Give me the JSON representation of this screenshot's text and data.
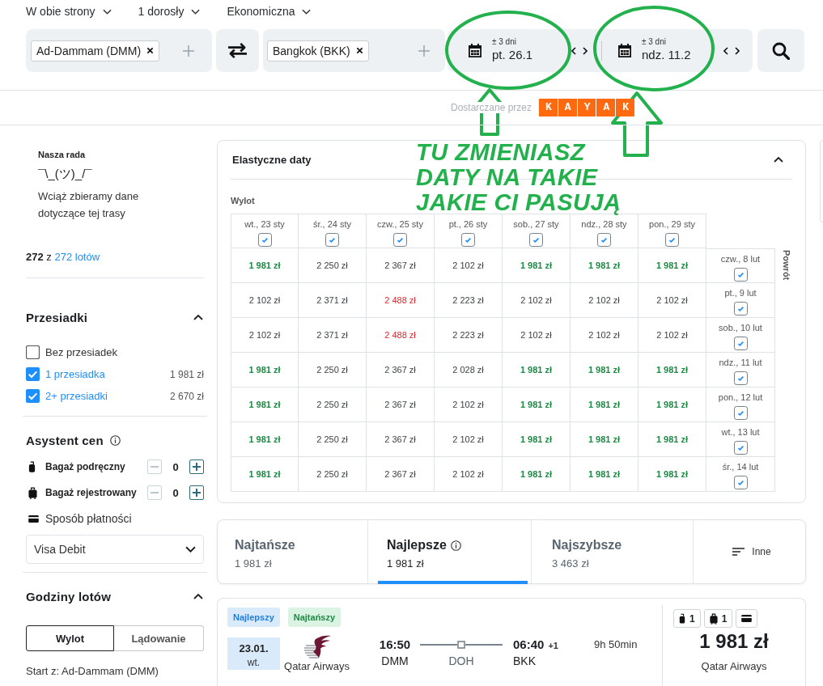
{
  "trip_options": [
    {
      "label": "W obie strony"
    },
    {
      "label": "1 dorosły"
    },
    {
      "label": "Ekonomiczna"
    }
  ],
  "search": {
    "origin": "Ad-Dammam (DMM)",
    "destination": "Bangkok (BKK)",
    "dates": [
      {
        "flex": "± 3 dni",
        "value": "pt. 26.1"
      },
      {
        "flex": "± 3 dni",
        "value": "ndz. 11.2"
      }
    ]
  },
  "provider": {
    "label": "Dostarczane przez",
    "logo": "KAYAK"
  },
  "annotation": {
    "lines": [
      "TU ZMIENIASZ",
      "DATY NA TAKIE",
      "JAKIE CI PASUJĄ"
    ]
  },
  "sidebar": {
    "advice": {
      "title": "Nasza rada",
      "shrug": "¯\\_(ツ)_/¯",
      "text": "Wciąż zbieramy dane dotyczące tej trasy"
    },
    "count": {
      "text": "**272** z",
      "link": "272 lotów"
    },
    "stops": {
      "title": "Przesiadki",
      "expanded": true,
      "options": [
        {
          "label": "Bez przesiadek",
          "checked": false
        },
        {
          "label": "1 przesiadka",
          "checked": true,
          "price": "1 981 zł"
        },
        {
          "label": "2+ przesiadki",
          "checked": true,
          "price": "2 670 zł"
        }
      ]
    },
    "price_assistant": {
      "title": "Asystent cen",
      "bags": [
        {
          "kind": "carry_on",
          "label": "Bagaż podręczny",
          "count": "0",
          "decrease_disabled": true
        },
        {
          "kind": "checked_bag",
          "label": "Bagaż rejestrowany",
          "count": "0",
          "decrease_disabled": true
        }
      ],
      "payment": {
        "label": "Sposób płatności",
        "value": "Visa Debit"
      }
    },
    "flight_times": {
      "title": "Godziny lotów",
      "expanded": true,
      "modes": [
        {
          "label": "Wylot",
          "selected": true
        },
        {
          "label": "Lądowanie",
          "selected": false
        }
      ],
      "start": "Start z: Ad-Dammam (DMM)"
    }
  },
  "flexible_dates": {
    "title": "Elastyczne daty",
    "expanded": true,
    "departure_label": "Wylot",
    "return_label": "Powrót",
    "departures": [
      {
        "label": "wt., 23 sty",
        "checked": true
      },
      {
        "label": "śr., 24 sty",
        "checked": true
      },
      {
        "label": "czw., 25 sty",
        "checked": true
      },
      {
        "label": "pt., 26 sty",
        "checked": true
      },
      {
        "label": "sob., 27 sty",
        "checked": true
      },
      {
        "label": "ndz., 28 sty",
        "checked": true
      },
      {
        "label": "pon., 29 sty",
        "checked": true
      }
    ],
    "returns": [
      {
        "label": "czw., 8 lut",
        "checked": true,
        "prices": [
          {
            "text": "1 981 zł",
            "kind": "low"
          },
          {
            "text": "2 250 zł",
            "kind": "mid"
          },
          {
            "text": "2 367 zł",
            "kind": "mid"
          },
          {
            "text": "2 102 zł",
            "kind": "mid"
          },
          {
            "text": "1 981 zł",
            "kind": "low"
          },
          {
            "text": "1 981 zł",
            "kind": "low"
          },
          {
            "text": "1 981 zł",
            "kind": "low"
          }
        ]
      },
      {
        "label": "pt., 9 lut",
        "checked": true,
        "prices": [
          {
            "text": "2 102 zł",
            "kind": "mid"
          },
          {
            "text": "2 371 zł",
            "kind": "mid"
          },
          {
            "text": "2 488 zł",
            "kind": "high"
          },
          {
            "text": "2 223 zł",
            "kind": "mid"
          },
          {
            "text": "2 102 zł",
            "kind": "mid"
          },
          {
            "text": "2 102 zł",
            "kind": "mid"
          },
          {
            "text": "2 102 zł",
            "kind": "mid"
          }
        ]
      },
      {
        "label": "sob., 10 lut",
        "checked": true,
        "prices": [
          {
            "text": "2 102 zł",
            "kind": "mid"
          },
          {
            "text": "2 371 zł",
            "kind": "mid"
          },
          {
            "text": "2 488 zł",
            "kind": "high"
          },
          {
            "text": "2 223 zł",
            "kind": "mid"
          },
          {
            "text": "2 102 zł",
            "kind": "mid"
          },
          {
            "text": "2 102 zł",
            "kind": "mid"
          },
          {
            "text": "2 102 zł",
            "kind": "mid"
          }
        ]
      },
      {
        "label": "ndz., 11 lut",
        "checked": true,
        "prices": [
          {
            "text": "1 981 zł",
            "kind": "low"
          },
          {
            "text": "2 250 zł",
            "kind": "mid"
          },
          {
            "text": "2 367 zł",
            "kind": "mid"
          },
          {
            "text": "2 028 zł",
            "kind": "mid"
          },
          {
            "text": "1 981 zł",
            "kind": "low"
          },
          {
            "text": "1 981 zł",
            "kind": "low"
          },
          {
            "text": "1 981 zł",
            "kind": "low"
          }
        ]
      },
      {
        "label": "pon., 12 lut",
        "checked": true,
        "prices": [
          {
            "text": "1 981 zł",
            "kind": "low"
          },
          {
            "text": "2 250 zł",
            "kind": "mid"
          },
          {
            "text": "2 367 zł",
            "kind": "mid"
          },
          {
            "text": "2 102 zł",
            "kind": "mid"
          },
          {
            "text": "1 981 zł",
            "kind": "low"
          },
          {
            "text": "1 981 zł",
            "kind": "low"
          },
          {
            "text": "1 981 zł",
            "kind": "low"
          }
        ]
      },
      {
        "label": "wt., 13 lut",
        "checked": true,
        "prices": [
          {
            "text": "1 981 zł",
            "kind": "low"
          },
          {
            "text": "2 250 zł",
            "kind": "mid"
          },
          {
            "text": "2 367 zł",
            "kind": "mid"
          },
          {
            "text": "2 102 zł",
            "kind": "mid"
          },
          {
            "text": "1 981 zł",
            "kind": "low"
          },
          {
            "text": "1 981 zł",
            "kind": "low"
          },
          {
            "text": "1 981 zł",
            "kind": "low"
          }
        ]
      },
      {
        "label": "śr., 14 lut",
        "checked": true,
        "prices": [
          {
            "text": "1 981 zł",
            "kind": "low"
          },
          {
            "text": "2 250 zł",
            "kind": "mid"
          },
          {
            "text": "2 367 zł",
            "kind": "mid"
          },
          {
            "text": "2 102 zł",
            "kind": "mid"
          },
          {
            "text": "1 981 zł",
            "kind": "low"
          },
          {
            "text": "1 981 zł",
            "kind": "low"
          },
          {
            "text": "1 981 zł",
            "kind": "low"
          }
        ]
      }
    ]
  },
  "sort_tabs": [
    {
      "label": "Najtańsze",
      "price": "1 981 zł",
      "selected": false,
      "info": false
    },
    {
      "label": "Najlepsze",
      "price": "1 981 zł",
      "selected": true,
      "info": true
    },
    {
      "label": "Najszybsze",
      "price": "3 463 zł",
      "selected": false,
      "info": false
    }
  ],
  "more_sort": {
    "label": "Inne"
  },
  "result": {
    "badges": [
      {
        "label": "Najlepszy",
        "kind": "best"
      },
      {
        "label": "Najtańszy",
        "kind": "cheapest"
      }
    ],
    "date": "23.01.",
    "weekday": "wt.",
    "airline": "Qatar Airways",
    "departure": {
      "time": "16:50",
      "code": "DMM"
    },
    "stop": "DOH",
    "arrival": {
      "time": "06:40",
      "day_offset": "+1",
      "code": "BKK"
    },
    "duration": "9h 50min",
    "fees": [
      {
        "kind": "carry_on",
        "count": "1"
      },
      {
        "kind": "checked_bag",
        "count": "1"
      },
      {
        "kind": "card"
      }
    ],
    "price": "1 981 zł",
    "price_airline": "Qatar Airways"
  }
}
